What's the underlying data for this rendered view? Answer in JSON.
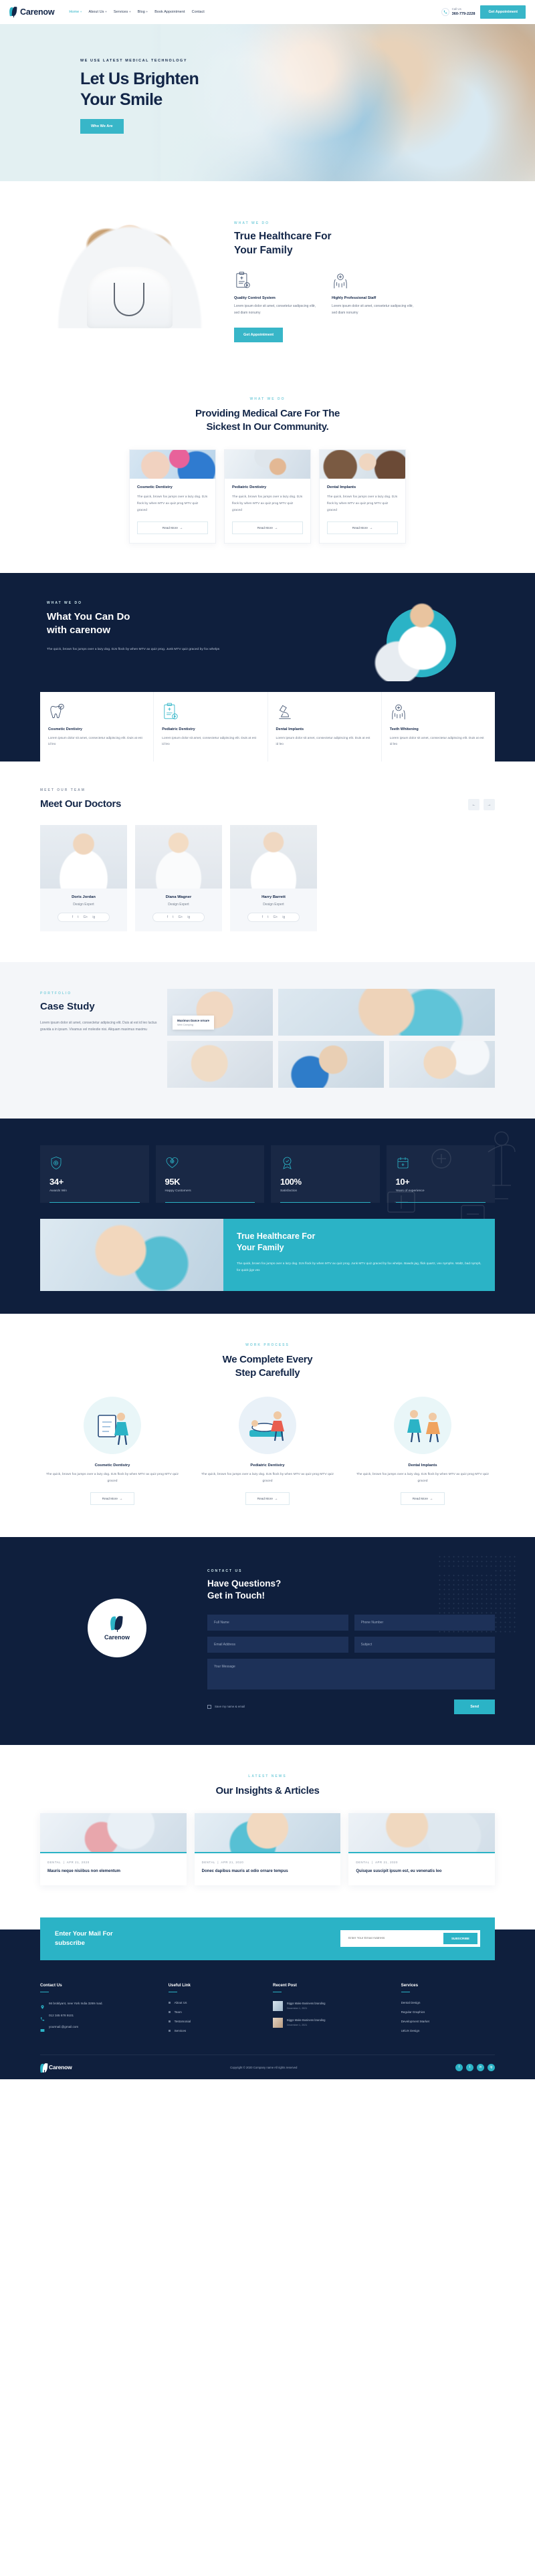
{
  "brand": {
    "name": "Carenow"
  },
  "header": {
    "nav": [
      {
        "label": "Home",
        "caret": "+",
        "active": true
      },
      {
        "label": "About Us",
        "caret": "+",
        "active": false
      },
      {
        "label": "Services",
        "caret": "+",
        "active": false
      },
      {
        "label": "Blog",
        "caret": "+",
        "active": false
      },
      {
        "label": "Book Appointment",
        "caret": "",
        "active": false
      },
      {
        "label": "Contact",
        "caret": "",
        "active": false
      }
    ],
    "call_label": "Call Us",
    "phone": "360-779-2228",
    "cta": "Get Appointment"
  },
  "hero": {
    "eyebrow": "WE USE LATEST MEDICAL TECHNOLOGY",
    "title_line1": "Let Us Brighten",
    "title_line2": "Your Smile",
    "button": "Who We Are"
  },
  "about": {
    "eyebrow": "WHAT WE DO",
    "title_line1": "True Healthcare For",
    "title_line2": "Your Family",
    "features": [
      {
        "icon": "clipboard-report-icon",
        "title": "Quality Control System",
        "text": "Lorem ipsum dolor sit amet, consetetur sadipscing elitr, sed diam nonumy"
      },
      {
        "icon": "hands-care-icon",
        "title": "Highly Professional Staff",
        "text": "Lorem ipsum dolor sit amet, consetetur sadipscing elitr, sed diam nonumy"
      }
    ],
    "button": "Get Appointment"
  },
  "services": {
    "eyebrow": "WHAT WE DO",
    "title_line1": "Providing Medical Care For The",
    "title_line2": "Sickest In Our Community.",
    "cards": [
      {
        "title": "Cosmetic Dentistry",
        "text": "The quick, brown fox jumps over a lazy dog. DJs flock by when MTV ax quiz prog MTV quiz graced",
        "button": "Read More"
      },
      {
        "title": "Pediatric Dentistry",
        "text": "The quick, brown fox jumps over a lazy dog. DJs flock by when MTV ax quiz prog MTV quiz graced",
        "button": "Read More"
      },
      {
        "title": "Dental Implants",
        "text": "The quick, brown fox jumps over a lazy dog. DJs flock by when MTV ax quiz prog MTV quiz graced",
        "button": "Read More"
      }
    ]
  },
  "whatyoucando": {
    "eyebrow": "WHAT WE DO",
    "title_line1": "What You Can Do",
    "title_line2": "with carenow",
    "text": "The quick, brown fox jumps over a lazy dog. DJs flock by when MTV ax quiz prog. Junk MTV quiz graced by fox whelps",
    "items": [
      {
        "icon": "tooth-check-icon",
        "title": "Cosmetic Dentistry",
        "text": "Lorem ipsum dolor sit amet, consectetur adipiscing elit. Duis at est id leo"
      },
      {
        "icon": "clipboard-plus-icon",
        "title": "Pediatric Dentistry",
        "text": "Lorem ipsum dolor sit amet, consectetur adipiscing elit. Duis at est id leo"
      },
      {
        "icon": "microscope-icon",
        "title": "Dental Implants",
        "text": "Lorem ipsum dolor sit amet, consectetur adipiscing elit. Duis at est id leo"
      },
      {
        "icon": "hands-care-icon",
        "title": "Teeth Whitening",
        "text": "Lorem ipsum dolor sit amet, consectetur adipiscing elit. Duis at est id leo"
      }
    ]
  },
  "doctors": {
    "eyebrow": "MEET OUR TEAM",
    "title": "Meet Our Doctors",
    "prev_icon": "arrow-left-icon",
    "next_icon": "arrow-right-icon",
    "list": [
      {
        "name": "Doris Jordan",
        "role": "Design Expert"
      },
      {
        "name": "Diana Wagner",
        "role": "Design Expert"
      },
      {
        "name": "Harry Barrett",
        "role": "Design Expert"
      }
    ],
    "socials": [
      "f",
      "t",
      "G+",
      "ig"
    ]
  },
  "casestudy": {
    "eyebrow": "PORTFOLIO",
    "title": "Case Study",
    "text": "Lorem ipsum dolor sit amet, consectetur adipiscing elit. Duis at est id leo luctus gravida a in ipsum. Vivamus vel molestie nisi. Aliquam maximus maximu",
    "badge_title": "Maximus Dance ornare",
    "badge_sub": "Web Camping"
  },
  "stats": [
    {
      "icon": "shield-check-icon",
      "number": "34+",
      "label": "Awards Win"
    },
    {
      "icon": "heart-care-icon",
      "number": "95K",
      "label": "Happy Customers"
    },
    {
      "icon": "medal-icon",
      "number": "100%",
      "label": "Satisfaction"
    },
    {
      "icon": "calendar-icon",
      "number": "10+",
      "label": "Years of experience"
    }
  ],
  "cta_banner": {
    "title_line1": "True Healthcare For",
    "title_line2": "Your Family",
    "text": "The quick, brown fox jumps over a lazy dog. DJs flock by when MTV ax quiz prog. Junk MTV quiz graced by fox whelps. Bawds jag, flick quartz, vex nymphs. Waltz, bad nymph, for quick jigs vex"
  },
  "process": {
    "eyebrow": "WORK PROCESS",
    "title_line1": "We Complete Every",
    "title_line2": "Step Carefully",
    "steps": [
      {
        "title": "Cosmetic Dentistry",
        "text": "The quick, brown fox jumps over a lazy dog. DJs flock by when MTV ax quiz prog MTV quiz graced",
        "button": "Read More"
      },
      {
        "title": "Pediatric Dentistry",
        "text": "The quick, brown fox jumps over a lazy dog. DJs flock by when MTV ax quiz prog MTV quiz graced",
        "button": "Read More"
      },
      {
        "title": "Dental Implants",
        "text": "The quick, brown fox jumps over a lazy dog. DJs flock by when MTV ax quiz prog MTV quiz graced",
        "button": "Read More"
      }
    ]
  },
  "contact": {
    "eyebrow": "CONTACT US",
    "title_line1": "Have Questions?",
    "title_line2": "Get in Touch!",
    "badge_name": "Carenow",
    "fields": {
      "fullname": "Full Name",
      "phone": "Phone Number",
      "email": "Email Address",
      "subject": "Subject",
      "message": "Your Message"
    },
    "consent": "Save my name & email",
    "submit": "Send"
  },
  "blog": {
    "eyebrow": "LATEST NEWS",
    "title": "Our Insights & Articles",
    "posts": [
      {
        "category": "DENTAL",
        "date": "APR 21, 2020",
        "title": "Mauris neque nisiibus non elementum"
      },
      {
        "category": "DENTAL",
        "date": "APR 21, 2020",
        "title": "Donec dapibus mauris at odio ornare tempus"
      },
      {
        "category": "DENTAL",
        "date": "APR 21, 2020",
        "title": "Quisque suscipit ipsum est, eu venenatis leo"
      }
    ]
  },
  "newsletter": {
    "title_line1": "Enter Your Mail For",
    "title_line2": "subscribe",
    "placeholder": "Enter Your Email Address",
    "button": "SUBSCRIBE"
  },
  "footer": {
    "contact": {
      "heading": "Contact Us",
      "address": "66 broklyant, new York India 3269 road.",
      "phone": "012 345 678 9101",
      "email": "yourmail.@gmail.com"
    },
    "useful": {
      "heading": "Useful Link",
      "links": [
        "About Us",
        "Team",
        "Testomonial",
        "Services"
      ]
    },
    "recent": {
      "heading": "Recent Post",
      "posts": [
        {
          "title": "Biggs Make Business branding",
          "date": "December 1, 2021"
        },
        {
          "title": "Biggs Make Business branding",
          "date": "December 1, 2021"
        }
      ]
    },
    "services": {
      "heading": "Services",
      "links": [
        "Dental Design",
        "Regular Graphics",
        "Development Market",
        "UI/UX Design"
      ]
    },
    "copyright": "Copyright © 2020 Company name All rights reserved",
    "socials": [
      "f",
      "t",
      "in",
      "ig"
    ]
  }
}
